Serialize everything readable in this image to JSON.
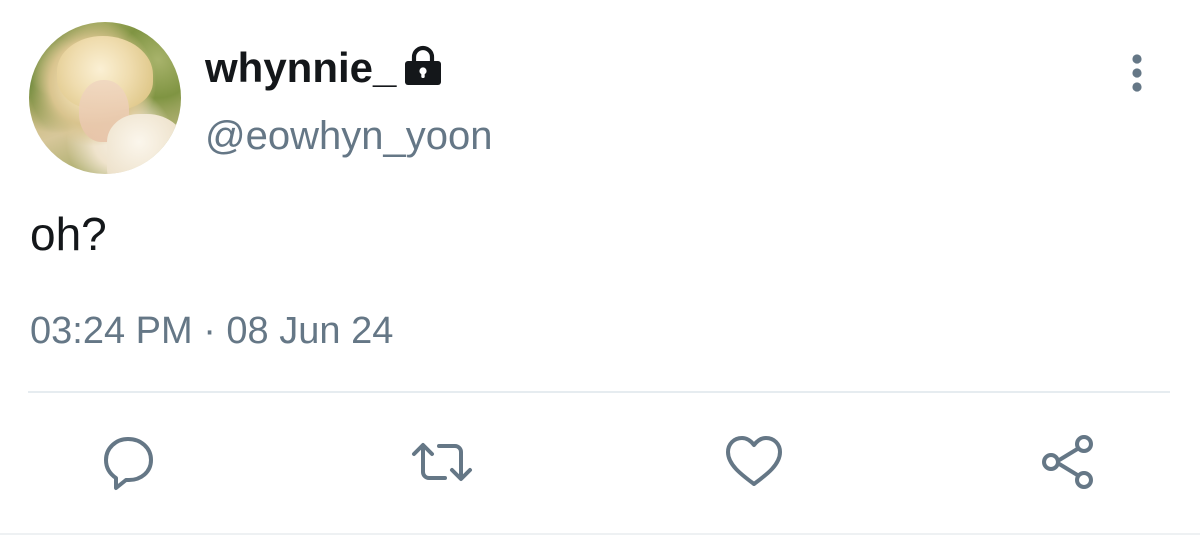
{
  "tweet": {
    "author": {
      "display_name": "whynnie_",
      "handle": "@eowhyn_yoon",
      "protected_icon": "lock-icon"
    },
    "text": "oh?",
    "timestamp": "03:24 PM · 08 Jun 24"
  },
  "actions": {
    "reply_icon": "reply-icon",
    "retweet_icon": "retweet-icon",
    "like_icon": "heart-icon",
    "share_icon": "share-icon",
    "more_icon": "more-vertical-icon"
  },
  "colors": {
    "text_primary": "#14171a",
    "text_secondary": "#657786",
    "divider": "#e6ecf0"
  }
}
